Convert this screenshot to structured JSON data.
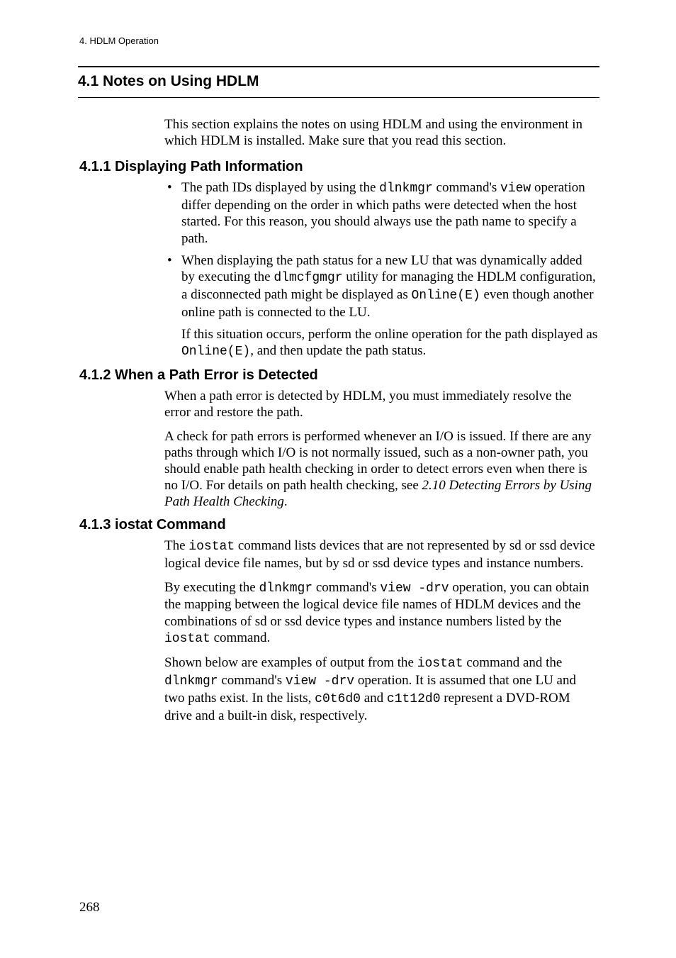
{
  "running_head": "4.  HDLM Operation",
  "h1": "4.1  Notes on Using HDLM",
  "intro": "This section explains the notes on using HDLM and using the environment in which HDLM is installed. Make sure that you read this section.",
  "sections": {
    "s411": {
      "title": "4.1.1  Displaying Path Information",
      "bullet1_pre": "The path IDs displayed by using the ",
      "bullet1_code1": "dlnkmgr",
      "bullet1_mid1": " command's ",
      "bullet1_code2": "view",
      "bullet1_post": " operation differ depending on the order in which paths were detected when the host started. For this reason, you should always use the path name to specify a path.",
      "bullet2_pre": "When displaying the path status for a new LU that was dynamically added by executing the ",
      "bullet2_code1": "dlmcfgmgr",
      "bullet2_mid1": " utility for managing the HDLM configuration, a disconnected path might be displayed as ",
      "bullet2_code2": "Online(E)",
      "bullet2_post": " even though another online path is connected to the LU.",
      "sub_pre": "If this situation occurs, perform the online operation for the path displayed as ",
      "sub_code": "Online(E)",
      "sub_post": ", and then update the path status."
    },
    "s412": {
      "title": "4.1.2  When a Path Error is Detected",
      "p1": "When a path error is detected by HDLM, you must immediately resolve the error and restore the path.",
      "p2_pre": "A check for path errors is performed whenever an I/O is issued. If there are any paths through which I/O is not normally issued, such as a non-owner path, you should enable path health checking in order to detect errors even when there is no I/O. For details on path health checking, see ",
      "p2_ital": "2.10  Detecting Errors by Using Path Health Checking",
      "p2_post": "."
    },
    "s413": {
      "title": "4.1.3  iostat Command",
      "p1_pre": "The ",
      "p1_code1": "iostat",
      "p1_post": " command lists devices that are not represented by sd or ssd device logical device file names, but by sd or ssd device types and instance numbers.",
      "p2_pre": "By executing the ",
      "p2_code1": "dlnkmgr",
      "p2_mid1": " command's ",
      "p2_code2": "view -drv",
      "p2_mid2": " operation, you can obtain the mapping between the logical device file names of HDLM devices and the combinations of sd or ssd device types and instance numbers listed by the ",
      "p2_code3": "iostat",
      "p2_post": " command.",
      "p3_pre": "Shown below are examples of output from the ",
      "p3_code1": "iostat",
      "p3_mid1": " command and the ",
      "p3_code2": "dlnkmgr",
      "p3_mid2": " command's ",
      "p3_code3": "view -drv",
      "p3_mid3": " operation. It is assumed that one LU and two paths exist. In the lists, ",
      "p3_code4": "c0t6d0",
      "p3_mid4": " and ",
      "p3_code5": "c1t12d0",
      "p3_post": " represent a DVD-ROM drive and a built-in disk, respectively."
    }
  },
  "page_number": "268"
}
